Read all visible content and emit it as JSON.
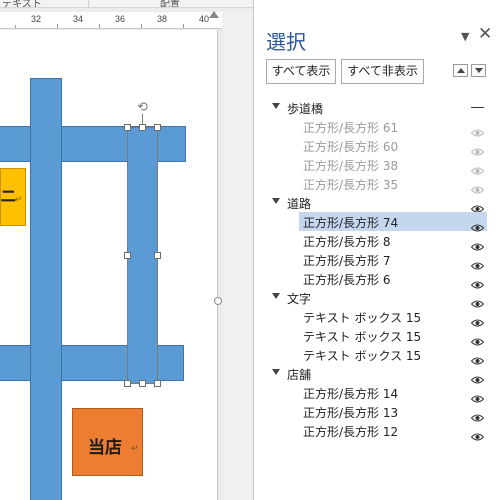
{
  "ribbon": {
    "groups": [
      "テキスト",
      "配置"
    ]
  },
  "ruler": {
    "ticks": [
      "32",
      "34",
      "36",
      "38",
      "40"
    ]
  },
  "document": {
    "convenience_text": "ニ",
    "store_text": "当店",
    "paragraph_mark": "↵"
  },
  "pane": {
    "title": "選択",
    "menu_icon": "dropdown-triangle-icon",
    "close_icon": "close-icon",
    "show_all_label": "すべて表示",
    "hide_all_label": "すべて非表示",
    "bring_forward_icon": "triangle-up-icon",
    "send_backward_icon": "triangle-down-icon",
    "groups": [
      {
        "name": "歩道橋",
        "visible": false,
        "items": [
          {
            "name": "正方形/長方形 61",
            "visible": false,
            "selected": false
          },
          {
            "name": "正方形/長方形 60",
            "visible": false,
            "selected": false
          },
          {
            "name": "正方形/長方形 38",
            "visible": false,
            "selected": false
          },
          {
            "name": "正方形/長方形 35",
            "visible": false,
            "selected": false
          }
        ]
      },
      {
        "name": "道路",
        "visible": true,
        "items": [
          {
            "name": "正方形/長方形 74",
            "visible": true,
            "selected": true
          },
          {
            "name": "正方形/長方形 8",
            "visible": true,
            "selected": false
          },
          {
            "name": "正方形/長方形 7",
            "visible": true,
            "selected": false
          },
          {
            "name": "正方形/長方形 6",
            "visible": true,
            "selected": false
          }
        ]
      },
      {
        "name": "文字",
        "visible": true,
        "items": [
          {
            "name": "テキスト ボックス 15",
            "visible": true,
            "selected": false
          },
          {
            "name": "テキスト ボックス 15",
            "visible": true,
            "selected": false
          },
          {
            "name": "テキスト ボックス 15",
            "visible": true,
            "selected": false
          }
        ]
      },
      {
        "name": "店舗",
        "visible": true,
        "items": [
          {
            "name": "正方形/長方形 14",
            "visible": true,
            "selected": false
          },
          {
            "name": "正方形/長方形 13",
            "visible": true,
            "selected": false
          },
          {
            "name": "正方形/長方形 12",
            "visible": true,
            "selected": false
          }
        ]
      }
    ]
  },
  "colors": {
    "road_blue": "#5b9bd5",
    "convenience_yellow": "#ffc000",
    "store_orange": "#ed7d31",
    "title_blue": "#2b579a",
    "selection_highlight": "#c5d7ef",
    "hidden_text": "#9a9a9a"
  }
}
